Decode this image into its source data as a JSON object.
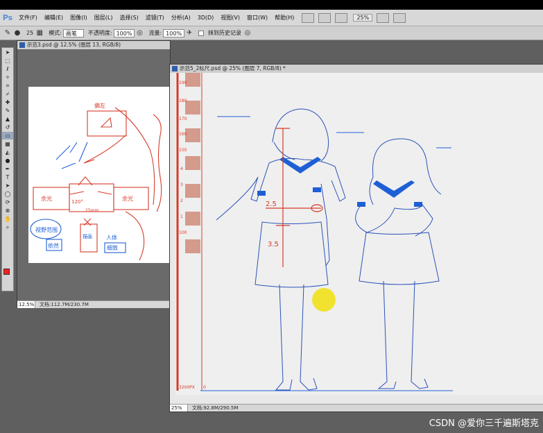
{
  "app": {
    "logo": "Ps"
  },
  "menubar": {
    "items": [
      "文件(F)",
      "编辑(E)",
      "图像(I)",
      "图层(L)",
      "选择(S)",
      "滤镜(T)",
      "分析(A)",
      "3D(D)",
      "视图(V)",
      "窗口(W)",
      "帮助(H)"
    ],
    "zoom": "25%"
  },
  "options": {
    "brush_size": "25",
    "mode_label": "模式:",
    "mode_value": "画笔",
    "opacity_label": "不透明度:",
    "opacity_value": "100%",
    "flow_label": "流量:",
    "flow_value": "100%",
    "history_label": "抹到历史记录"
  },
  "doc1": {
    "title": "示范3.psd @ 12.5% (图层 13, RGB/8)",
    "zoom": "12.5%",
    "info": "文档:112.7M/230.7M",
    "notes": {
      "wall": "偏左",
      "angle": "120°",
      "dist": "25mm",
      "left": "余光",
      "right": "余光",
      "box1": "视野范围",
      "box2": "依然",
      "note3": "人体",
      "note4": "细致",
      "note5": "描画"
    }
  },
  "doc2": {
    "title": "示范5_2标尺.psd @ 25% (图层 7, RGB/8) *",
    "zoom": "25%",
    "info": "文档:92.8M/290.5M",
    "ruler_labels": [
      "190",
      "180",
      "170",
      "160",
      "150",
      "4",
      "3",
      "2",
      "1",
      "100"
    ],
    "ruler_base": "3200PX",
    "ruler_zero": "0",
    "marks": {
      "m1": "2.5",
      "m2": "3.5"
    }
  },
  "watermark": "CSDN @爱你三千遍斯塔克",
  "colors": {
    "accent": "#1f5fd6",
    "red": "#d63b2a",
    "pink": "#d49a8c",
    "foreground": "#e22222"
  }
}
